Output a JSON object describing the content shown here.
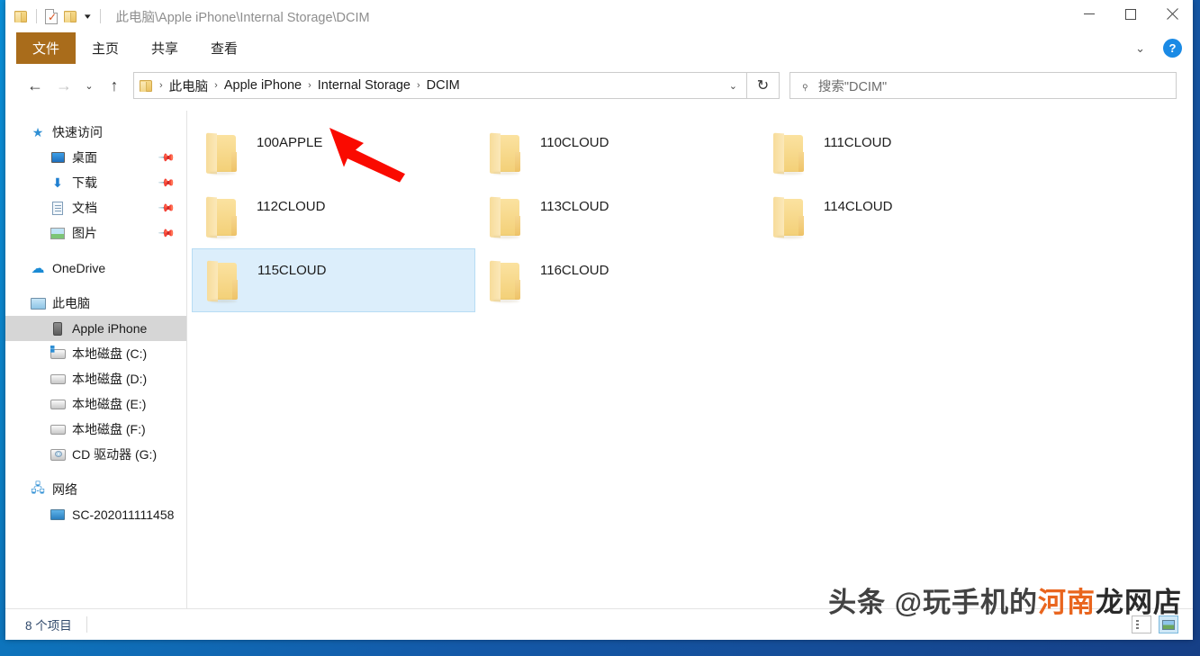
{
  "window": {
    "title_path": "此电脑\\Apple iPhone\\Internal Storage\\DCIM",
    "controls": {
      "minimize": "—",
      "maximize": "□",
      "close": "✕"
    }
  },
  "quick_access_toolbar": {
    "folder_icon": "folder-icon",
    "properties_icon": "properties-checkmark-icon",
    "new_folder_icon": "new-folder-icon",
    "customize_caret": "▾"
  },
  "ribbon": {
    "tabs": [
      {
        "label": "文件",
        "name": "tab-file",
        "active": true
      },
      {
        "label": "主页",
        "name": "tab-home",
        "active": false
      },
      {
        "label": "共享",
        "name": "tab-share",
        "active": false
      },
      {
        "label": "查看",
        "name": "tab-view",
        "active": false
      }
    ],
    "collapse_caret": "⌄",
    "help_label": "?"
  },
  "navigation": {
    "back": "←",
    "forward": "→",
    "recent_caret": "⌄",
    "up": "↑",
    "refresh": "↻",
    "address_caret": "⌄",
    "breadcrumbs": [
      {
        "label": "此电脑"
      },
      {
        "label": "Apple iPhone"
      },
      {
        "label": "Internal Storage"
      },
      {
        "label": "DCIM"
      }
    ],
    "separator": "›"
  },
  "search": {
    "icon": "search-icon",
    "placeholder": "搜索\"DCIM\""
  },
  "sidebar": {
    "items": [
      {
        "label": "快速访问",
        "icon": "star-pin-icon",
        "level": 0,
        "pinned": false,
        "selected": false
      },
      {
        "label": "桌面",
        "icon": "desktop-icon",
        "level": 1,
        "pinned": true,
        "selected": false
      },
      {
        "label": "下载",
        "icon": "download-icon",
        "level": 1,
        "pinned": true,
        "selected": false
      },
      {
        "label": "文档",
        "icon": "documents-icon",
        "level": 1,
        "pinned": true,
        "selected": false
      },
      {
        "label": "图片",
        "icon": "pictures-icon",
        "level": 1,
        "pinned": true,
        "selected": false
      },
      {
        "label": "OneDrive",
        "icon": "cloud-icon",
        "level": 0,
        "pinned": false,
        "selected": false
      },
      {
        "label": "此电脑",
        "icon": "this-pc-icon",
        "level": 0,
        "pinned": false,
        "selected": false
      },
      {
        "label": "Apple iPhone",
        "icon": "phone-icon",
        "level": 1,
        "pinned": false,
        "selected": true
      },
      {
        "label": "本地磁盘 (C:)",
        "icon": "system-drive-icon",
        "level": 1,
        "pinned": false,
        "selected": false
      },
      {
        "label": "本地磁盘 (D:)",
        "icon": "drive-icon",
        "level": 1,
        "pinned": false,
        "selected": false
      },
      {
        "label": "本地磁盘 (E:)",
        "icon": "drive-icon",
        "level": 1,
        "pinned": false,
        "selected": false
      },
      {
        "label": "本地磁盘 (F:)",
        "icon": "drive-icon",
        "level": 1,
        "pinned": false,
        "selected": false
      },
      {
        "label": "CD 驱动器 (G:)",
        "icon": "cd-drive-icon",
        "level": 1,
        "pinned": false,
        "selected": false
      },
      {
        "label": "网络",
        "icon": "network-icon",
        "level": 0,
        "pinned": false,
        "selected": false
      },
      {
        "label": "SC-202011111458",
        "icon": "network-pc-icon",
        "level": 1,
        "pinned": false,
        "selected": false
      }
    ]
  },
  "content": {
    "folders": [
      {
        "name": "100APPLE",
        "selected": false
      },
      {
        "name": "110CLOUD",
        "selected": false
      },
      {
        "name": "111CLOUD",
        "selected": false
      },
      {
        "name": "112CLOUD",
        "selected": false
      },
      {
        "name": "113CLOUD",
        "selected": false
      },
      {
        "name": "114CLOUD",
        "selected": false
      },
      {
        "name": "115CLOUD",
        "selected": true
      },
      {
        "name": "116CLOUD",
        "selected": false
      }
    ],
    "annotation": {
      "type": "arrow",
      "color": "#fa0a00",
      "points_to": "100APPLE"
    }
  },
  "statusbar": {
    "item_count": "8 个项目",
    "view_details_icon": "details-view-icon",
    "view_thumbnails_icon": "thumbnails-view-icon"
  },
  "watermark": {
    "part1": "头条 @玩手机的",
    "part2": "河南",
    "part3": "龙网店"
  },
  "colors": {
    "file_tab": "#a96c1b",
    "selection": "#dceefb",
    "selection_border": "#b7dcf4",
    "sidebar_selected": "#d6d6d6",
    "accent_blue": "#1a8ae5",
    "arrow_red": "#fa0a00",
    "folder_yellow": "#f3d078"
  }
}
